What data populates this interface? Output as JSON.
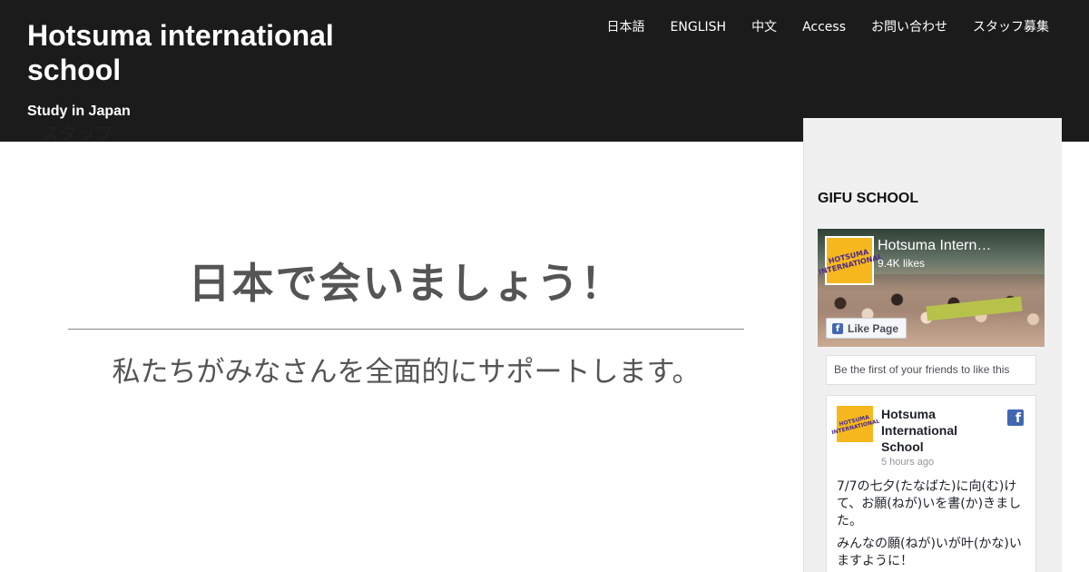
{
  "site": {
    "title": "Hotsuma international school",
    "tagline": "Study in Japan"
  },
  "nav": {
    "items": [
      {
        "label": "日本語"
      },
      {
        "label": "ENGLISH"
      },
      {
        "label": "中文"
      },
      {
        "label": "Access"
      },
      {
        "label": "お問い合わせ"
      },
      {
        "label": "スタッフ募集"
      }
    ]
  },
  "peek_text": "スタッフ",
  "hero": {
    "title": "日本で会いましょう！",
    "subtitle": "私たちがみなさんを全面的にサポートします。"
  },
  "sidebar": {
    "widget_title": "GIFU SCHOOL",
    "facebook": {
      "page_name": "Hotsuma Intern…",
      "likes": "9.4K likes",
      "like_button": "Like Page",
      "logo_text": "HOTSUMA INTERNATIONAL",
      "friends_text": "Be the first of your friends to like this",
      "post": {
        "author": "Hotsuma International School",
        "time": "5 hours ago",
        "paragraphs": [
          "7/7の七夕(たなばた)に向(む)けて、お願(ねが)いを書(か)きました。",
          "みんなの願(ねが)いが叶(かな)いますように！"
        ]
      }
    }
  }
}
